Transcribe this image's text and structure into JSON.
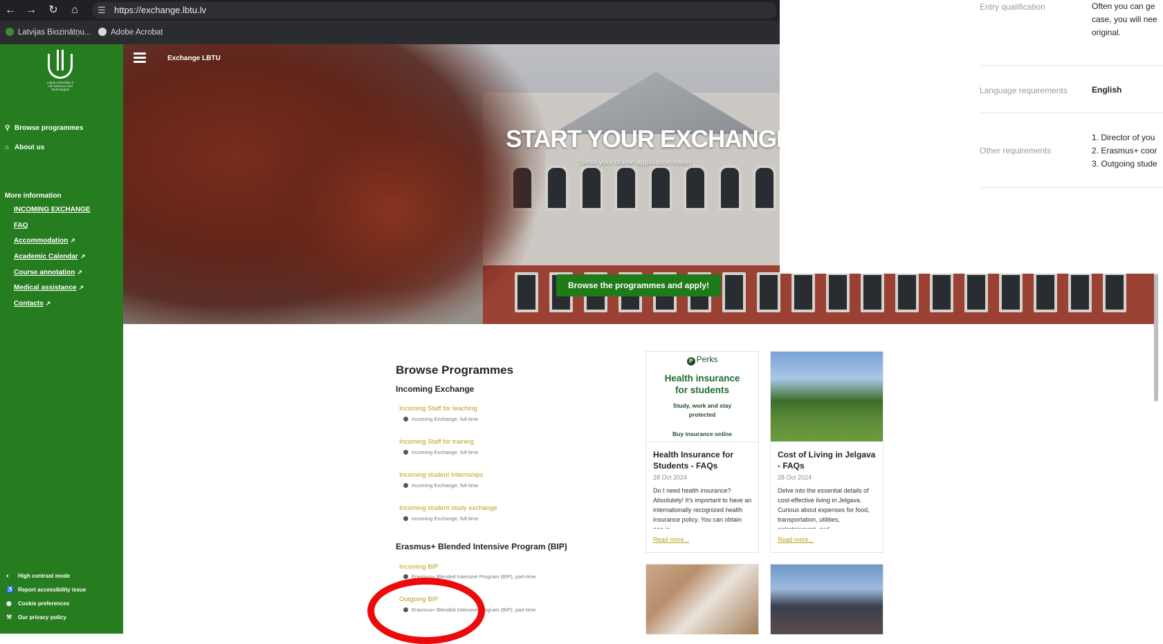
{
  "browser": {
    "url": "https://exchange.lbtu.lv",
    "bookmarks": [
      {
        "label": "Latvijas Biozinātņu..."
      },
      {
        "label": "Adobe Acrobat"
      }
    ]
  },
  "sidebar": {
    "logo_text": "Latvia University of Life Sciences and Technologies",
    "nav": [
      {
        "label": "Browse programmes",
        "icon": "search-icon"
      },
      {
        "label": "About us",
        "icon": "bank-icon"
      }
    ],
    "more_title": "More information",
    "links": [
      {
        "label": "INCOMING EXCHANGE",
        "external": false
      },
      {
        "label": "FAQ",
        "external": false
      },
      {
        "label": "Accommodation",
        "external": true
      },
      {
        "label": "Academic Calendar",
        "external": true
      },
      {
        "label": "Course annotation",
        "external": true
      },
      {
        "label": "Medical assistance",
        "external": true
      },
      {
        "label": "Contacts",
        "external": true
      }
    ],
    "footer": [
      {
        "label": "High contrast mode",
        "icon": "contrast-icon"
      },
      {
        "label": "Report accessibility issue",
        "icon": "accessibility-icon"
      },
      {
        "label": "Cookie preferences",
        "icon": "cookie-icon"
      },
      {
        "label": "Our privacy policy",
        "icon": "hammer-icon"
      }
    ]
  },
  "hero": {
    "site_name": "Exchange LBTU",
    "title": "START YOUR EXCHANGE!",
    "subtitle": "Send your online application easily",
    "cta": "Browse the programmes and apply!"
  },
  "detail_panel": {
    "rows": [
      {
        "label": "Entry qualification",
        "lines": [
          "Often you can ge",
          "case, you will nee",
          "original."
        ],
        "bold": false
      },
      {
        "label": "Language requirements",
        "lines": [
          "English"
        ],
        "bold": true
      },
      {
        "label": "Other requirements",
        "lines": [
          "1. Director of you",
          "2. Erasmus+ coor",
          "3. Outgoing stude"
        ],
        "bold": false
      }
    ]
  },
  "main": {
    "title": "Browse Programmes",
    "groups": [
      {
        "title": "Incoming Exchange",
        "programmes": [
          {
            "name": "Incoming Staff for teaching",
            "meta": "Incoming Exchange, full-time"
          },
          {
            "name": "Incoming Staff for training",
            "meta": "Incoming Exchange, full-time"
          },
          {
            "name": "Incoming student Internships",
            "meta": "Incoming Exchange, full-time"
          },
          {
            "name": "Incoming student study exchange",
            "meta": "Incoming Exchange, full-time"
          }
        ]
      },
      {
        "title": "Erasmus+ Blended Intensive Program (BIP)",
        "programmes": [
          {
            "name": "Incoming BIP",
            "meta": "Erasmus+ Blended Intensive Program (BIP), part-time"
          },
          {
            "name": "Outgoing BIP",
            "meta": "Erasmus+ Blended Intensive Program (BIP), part-time"
          }
        ]
      }
    ]
  },
  "cards": [
    {
      "promo": {
        "brand": "Perks",
        "headline_1": "Health insurance",
        "headline_2": "for students",
        "sub_1": "Study, work and stay",
        "sub_2": "protected",
        "buy": "Buy insurance online"
      },
      "title": "Health Insurance for Students - FAQs",
      "date": "28 Oct 2024",
      "text": "Do I need health insurance? Absolutely! It's important to have an internationally recognized health insurance policy. You can obtain one in",
      "more": "Read more..."
    },
    {
      "title": "Cost of Living in Jelgava - FAQs",
      "date": "28 Oct 2024",
      "text": "Delve into the essential details of cost-effective living in Jelgava. Curious about expenses for food, transportation, utilities, entertainment, and",
      "more": "Read more..."
    }
  ],
  "colors": {
    "sidebar_green": "#267d1f",
    "cta_green": "#1f7a18",
    "link_gold": "#b8a21a",
    "annotation_red": "#ee0a0a"
  }
}
